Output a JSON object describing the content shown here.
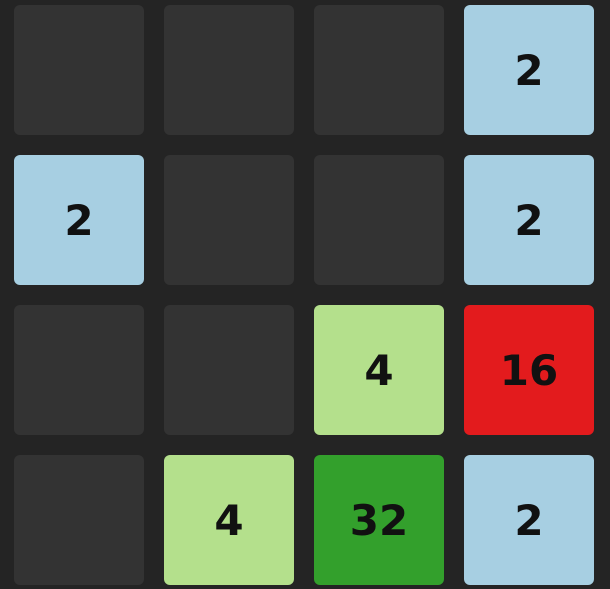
{
  "board": {
    "rows": [
      [
        "",
        "",
        "",
        "2"
      ],
      [
        "2",
        "",
        "",
        "2"
      ],
      [
        "",
        "",
        "4",
        "16"
      ],
      [
        "",
        "4",
        "32",
        "2"
      ]
    ]
  },
  "colors": {
    "background": "#242424",
    "empty": "#333333",
    "tile_2": "#a7cfe2",
    "tile_4": "#b4e08c",
    "tile_16": "#e31b1d",
    "tile_32": "#33a02c",
    "text": "#111111"
  }
}
